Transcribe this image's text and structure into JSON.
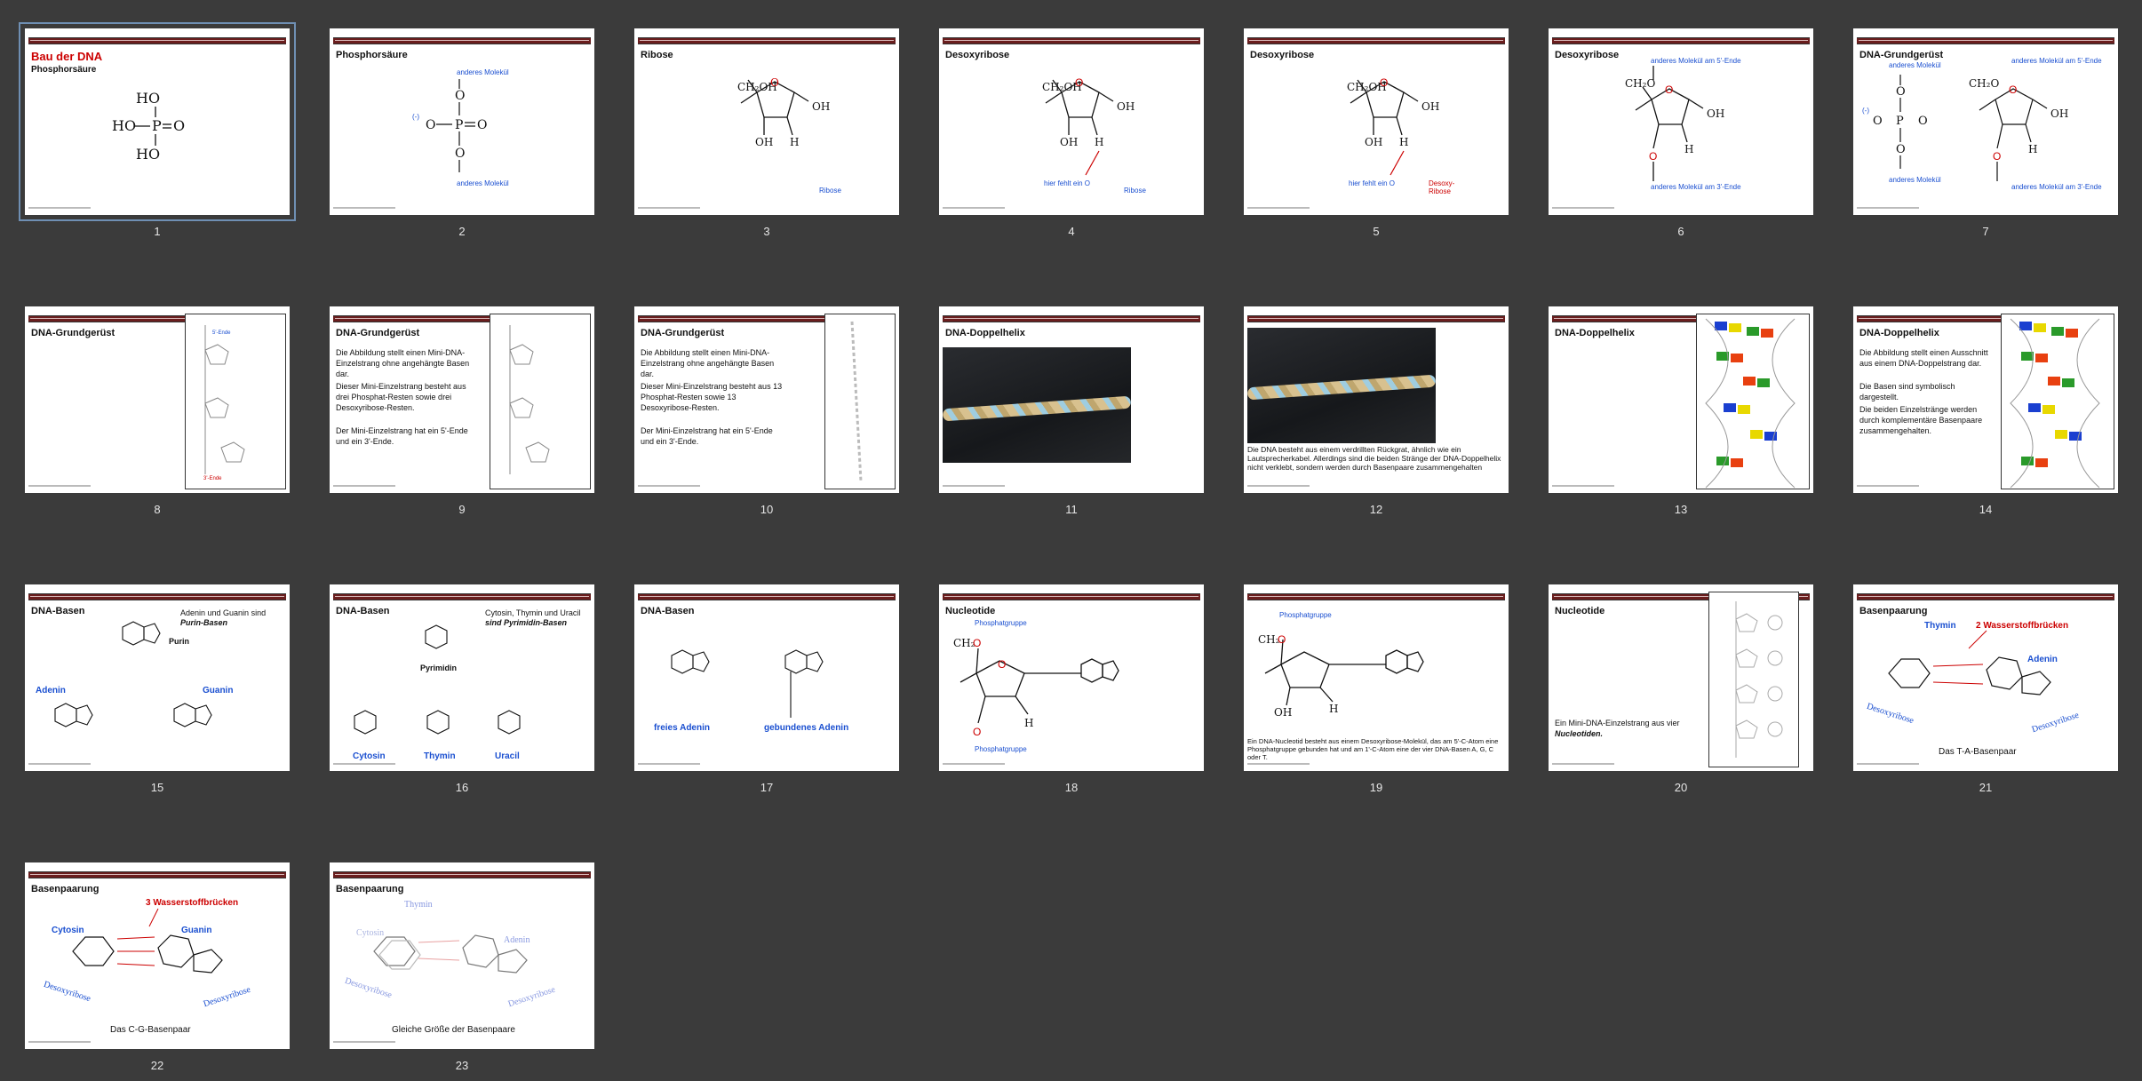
{
  "slides": [
    {
      "num": "1",
      "title": "Bau der DNA",
      "subtitle": "Phosphorsäure"
    },
    {
      "num": "2",
      "title": "Phosphorsäure",
      "labels": [
        "anderes Molekül",
        "anderes Molekül",
        "(-)"
      ]
    },
    {
      "num": "3",
      "title": "Ribose",
      "labels": [
        "Ribose"
      ]
    },
    {
      "num": "4",
      "title": "Desoxyribose",
      "labels": [
        "hier fehlt ein O",
        "Ribose"
      ]
    },
    {
      "num": "5",
      "title": "Desoxyribose",
      "labels": [
        "hier fehlt ein O",
        "Desoxy-",
        "Ribose"
      ]
    },
    {
      "num": "6",
      "title": "Desoxyribose",
      "labels": [
        "anderes Molekül am 5'-Ende",
        "anderes Molekül am 3'-Ende"
      ]
    },
    {
      "num": "7",
      "title": "DNA-Grundgerüst",
      "labels": [
        "anderes Molekül",
        "anderes Molekül am 5'-Ende",
        "anderes Molekül",
        "anderes Molekül am 3'-Ende",
        "(-)"
      ]
    },
    {
      "num": "8",
      "title": "DNA-Grundgerüst"
    },
    {
      "num": "9",
      "title": "DNA-Grundgerüst",
      "body": [
        "Die Abbildung stellt einen Mini-DNA-Einzelstrang ohne angehängte Basen dar.",
        "Dieser Mini-Einzelstrang besteht aus drei Phosphat-Resten sowie drei Desoxyribose-Resten.",
        "Der Mini-Einzelstrang hat ein 5'-Ende und ein 3'-Ende."
      ]
    },
    {
      "num": "10",
      "title": "DNA-Grundgerüst",
      "body": [
        "Die Abbildung stellt einen Mini-DNA-Einzelstrang ohne angehängte Basen dar.",
        "Dieser Mini-Einzelstrang besteht aus 13 Phosphat-Resten sowie 13 Desoxyribose-Resten.",
        "Der Mini-Einzelstrang hat ein 5'-Ende und ein 3'-Ende."
      ]
    },
    {
      "num": "11",
      "title": "DNA-Doppelhelix"
    },
    {
      "num": "12",
      "body": [
        "Die DNA besteht aus einem verdrillten Rückgrat, ähnlich wie ein Lautsprecherkabel. Allerdings sind die beiden Stränge der DNA-Doppelhelix nicht verklebt, sondern werden durch Basenpaare zusammengehalten"
      ]
    },
    {
      "num": "13",
      "title": "DNA-Doppelhelix"
    },
    {
      "num": "14",
      "title": "DNA-Doppelhelix",
      "body": [
        "Die Abbildung stellt einen Ausschnitt aus einem DNA-Doppelstrang dar.",
        "Die Basen sind symbolisch dargestellt.",
        "Die beiden Einzelstränge werden durch komplementäre Basenpaare zusammengehalten."
      ]
    },
    {
      "num": "15",
      "title": "DNA-Basen",
      "body": [
        "Adenin und Guanin sind",
        "Purin-Basen"
      ],
      "labels": [
        "Purin",
        "Adenin",
        "Guanin"
      ]
    },
    {
      "num": "16",
      "title": "DNA-Basen",
      "body": [
        "Cytosin, Thymin und Uracil",
        "sind Pyrimidin-Basen"
      ],
      "labels": [
        "Pyrimidin",
        "Cytosin",
        "Thymin",
        "Uracil"
      ]
    },
    {
      "num": "17",
      "title": "DNA-Basen",
      "labels": [
        "freies Adenin",
        "gebundenes Adenin"
      ]
    },
    {
      "num": "18",
      "title": "Nucleotide",
      "labels": [
        "Phosphatgruppe",
        "Phosphatgruppe"
      ]
    },
    {
      "num": "19",
      "labels": [
        "Phosphatgruppe"
      ],
      "body": [
        "Ein DNA-Nucleotid besteht aus einem Desoxyribose-Molekül, das am 5'-C-Atom eine Phosphatgruppe gebunden hat und am 1'-C-Atom eine der vier DNA-Basen A, G, C oder T."
      ]
    },
    {
      "num": "20",
      "title": "Nucleotide",
      "body": [
        "Ein Mini-DNA-Einzelstrang aus vier",
        "Nucleotiden."
      ]
    },
    {
      "num": "21",
      "title": "Basenpaarung",
      "labels": [
        "Thymin",
        "2 Wasserstoffbrücken",
        "Adenin",
        "Desoxyribose",
        "Desoxyribose"
      ],
      "caption": "Das T-A-Basenpaar"
    },
    {
      "num": "22",
      "title": "Basenpaarung",
      "labels": [
        "3 Wasserstoffbrücken",
        "Cytosin",
        "Guanin",
        "Desoxyribose",
        "Desoxyribose"
      ],
      "caption": "Das C-G-Basenpaar"
    },
    {
      "num": "23",
      "title": "Basenpaarung",
      "labels": [
        "Thymin",
        "Cytosin",
        "Adenin",
        "Desoxyribose",
        "Desoxyribose"
      ],
      "caption": "Gleiche Größe der Basenpaare"
    }
  ],
  "colors": {
    "background": "#3b3b3b",
    "header_bar": "#6a1e1e",
    "accent_red": "#cc0000",
    "accent_blue": "#1a4fd0",
    "selection": "#6f8fb3"
  }
}
